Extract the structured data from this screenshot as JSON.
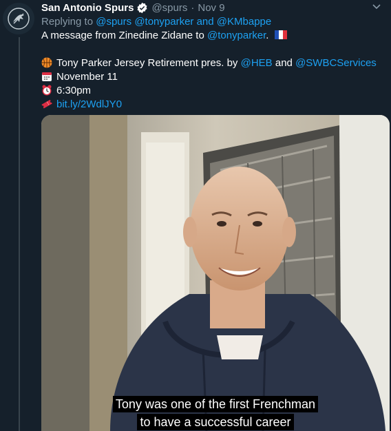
{
  "tweet": {
    "author_name": "San Antonio Spurs",
    "handle": "@spurs",
    "separator": "·",
    "date": "Nov 9",
    "replying_prefix": "Replying to",
    "replying_to": [
      "@spurs",
      "@tonyparker",
      "@KMbappe"
    ],
    "replying_and": "and",
    "line1_text": "A message from Zinedine Zidane to",
    "line1_mention": "@tonyparker",
    "line1_end": ".",
    "line1_flag": "flag-france-icon",
    "event_text": "Tony Parker Jersey Retirement pres. by",
    "event_sponsor1": "@HEB",
    "event_and": "and",
    "event_sponsor2": "@SWBCServices",
    "event_icon": "basketball-icon",
    "date_text": "November 11",
    "date_icon": "calendar-icon",
    "time_text": "6:30pm",
    "time_icon": "alarm-clock-icon",
    "link_text": "bit.ly/2WdlJY0",
    "link_icon": "ticket-icon"
  },
  "video": {
    "subtitle_line1": "Tony was one of the first Frenchman",
    "subtitle_line2": "to have a successful career"
  },
  "colors": {
    "background": "#15202b",
    "link": "#1da1f2",
    "muted": "#8899a6",
    "verified": "#ffffff"
  }
}
